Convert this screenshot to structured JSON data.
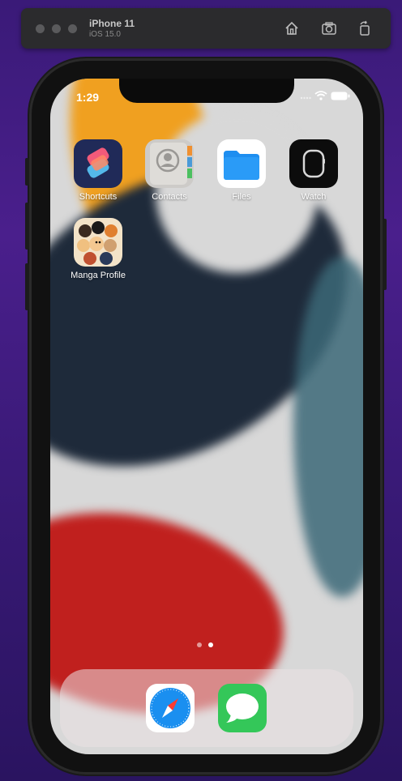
{
  "toolbar": {
    "device_name": "iPhone 11",
    "os_version": "iOS 15.0",
    "buttons": [
      {
        "name": "home-button",
        "icon": "home-icon"
      },
      {
        "name": "screenshot-button",
        "icon": "camera-icon"
      },
      {
        "name": "rotate-button",
        "icon": "rotate-icon"
      }
    ]
  },
  "status_bar": {
    "time": "1:29",
    "signal": "signal-dots",
    "wifi": "wifi-icon",
    "battery": "battery-icon"
  },
  "home_apps": [
    {
      "label": "Shortcuts",
      "icon": "shortcuts-icon"
    },
    {
      "label": "Contacts",
      "icon": "contacts-icon"
    },
    {
      "label": "Files",
      "icon": "files-icon"
    },
    {
      "label": "Watch",
      "icon": "watch-icon"
    },
    {
      "label": "Manga Profile",
      "icon": "manga-profile-icon"
    }
  ],
  "page_dots": {
    "count": 2,
    "active": 1
  },
  "dock_apps": [
    {
      "label": "Safari",
      "icon": "safari-icon"
    },
    {
      "label": "Messages",
      "icon": "messages-icon"
    }
  ],
  "colors": {
    "desktop_bg": "#3a1a78",
    "wallpaper_orange": "#f0a020",
    "wallpaper_navy": "#1e2a3a",
    "wallpaper_red": "#c0201e",
    "wallpaper_teal": "#3c6878",
    "files_blue": "#1e8ef0",
    "messages_green": "#34c759"
  }
}
